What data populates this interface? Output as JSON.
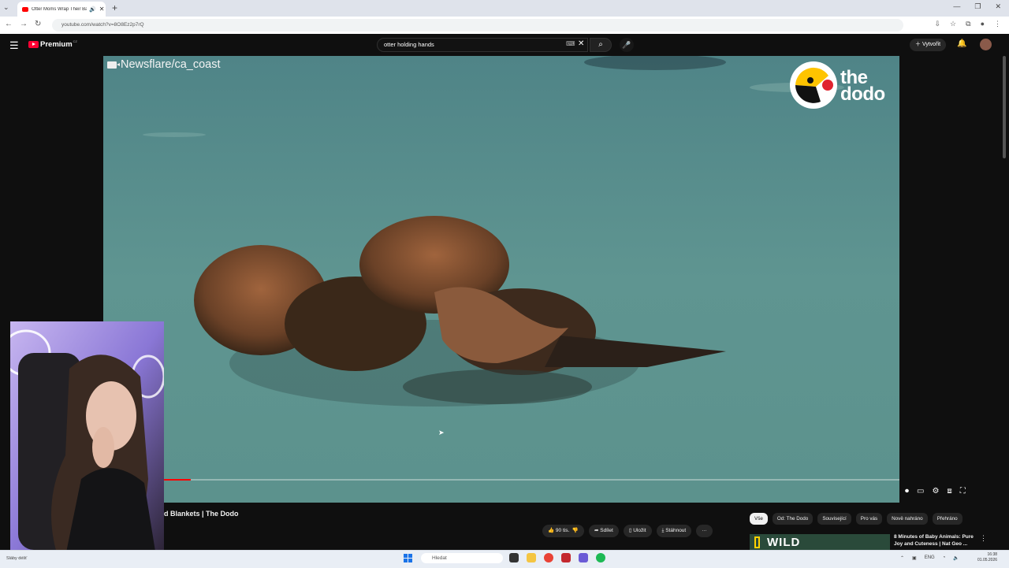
{
  "browser": {
    "tab_title": "Otter Moms Wrap Their Ba",
    "tab_close": "✕",
    "new_tab": "+",
    "url": "youtube.com/watch?v=8O8Ez2p7rQ",
    "window_controls": [
      "—",
      "❐",
      "✕"
    ]
  },
  "header": {
    "brand": "Premium",
    "country": "CZ",
    "search_value": "otter holding hands",
    "create_label": "Vytvořit"
  },
  "video": {
    "watermark": "Newsflare/ca_coast",
    "logo_text_line1": "the",
    "logo_text_line2": "dodo",
    "progress": 0.11,
    "title": "d Blankets | The Dodo"
  },
  "actions": {
    "likes": "90 tis.",
    "share": "Sdílet",
    "save": "Uložit",
    "download": "Stáhnout",
    "more": "···"
  },
  "chips": [
    "Vše",
    "Od: The Dodo",
    "Související",
    "Pro vás",
    "Nově nahráno",
    "Přehráno"
  ],
  "recommendation": {
    "thumb_text": "WILD",
    "title": "8 Minutes of Baby Animals: Pure Joy and Cuteness | Nat Geo ..."
  },
  "taskbar": {
    "weather": "Sláby déšť",
    "search_placeholder": "Hledat",
    "lang": "ENG",
    "time": "16:38",
    "date": "01.05.2026"
  },
  "colors": {
    "yt_red": "#ff0033",
    "water": "#5a8b8f",
    "dodo_yellow": "#ffc400"
  }
}
